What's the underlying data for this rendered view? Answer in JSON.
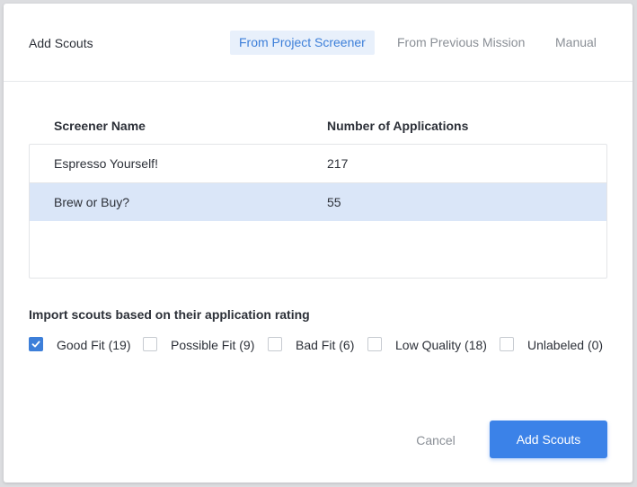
{
  "modal": {
    "title": "Add Scouts",
    "tabs": [
      {
        "label": "From Project Screener",
        "active": true
      },
      {
        "label": "From Previous Mission",
        "active": false
      },
      {
        "label": "Manual",
        "active": false
      }
    ]
  },
  "table": {
    "columns": [
      "Screener Name",
      "Number of Applications"
    ],
    "rows": [
      {
        "name": "Espresso Yourself!",
        "count": "217",
        "selected": false
      },
      {
        "name": "Brew or Buy?",
        "count": "55",
        "selected": true
      }
    ]
  },
  "filter": {
    "heading": "Import scouts based on their application rating",
    "options": [
      {
        "label": "Good Fit (19)",
        "checked": true
      },
      {
        "label": "Possible Fit (9)",
        "checked": false
      },
      {
        "label": "Bad Fit (6)",
        "checked": false
      },
      {
        "label": "Low Quality (18)",
        "checked": false
      },
      {
        "label": "Unlabeled (0)",
        "checked": false
      }
    ]
  },
  "footer": {
    "cancel_label": "Cancel",
    "submit_label": "Add Scouts"
  },
  "colors": {
    "accent": "#3b82e8",
    "selected_row": "#dae6f8",
    "active_tab_bg": "#e8f0fb"
  }
}
